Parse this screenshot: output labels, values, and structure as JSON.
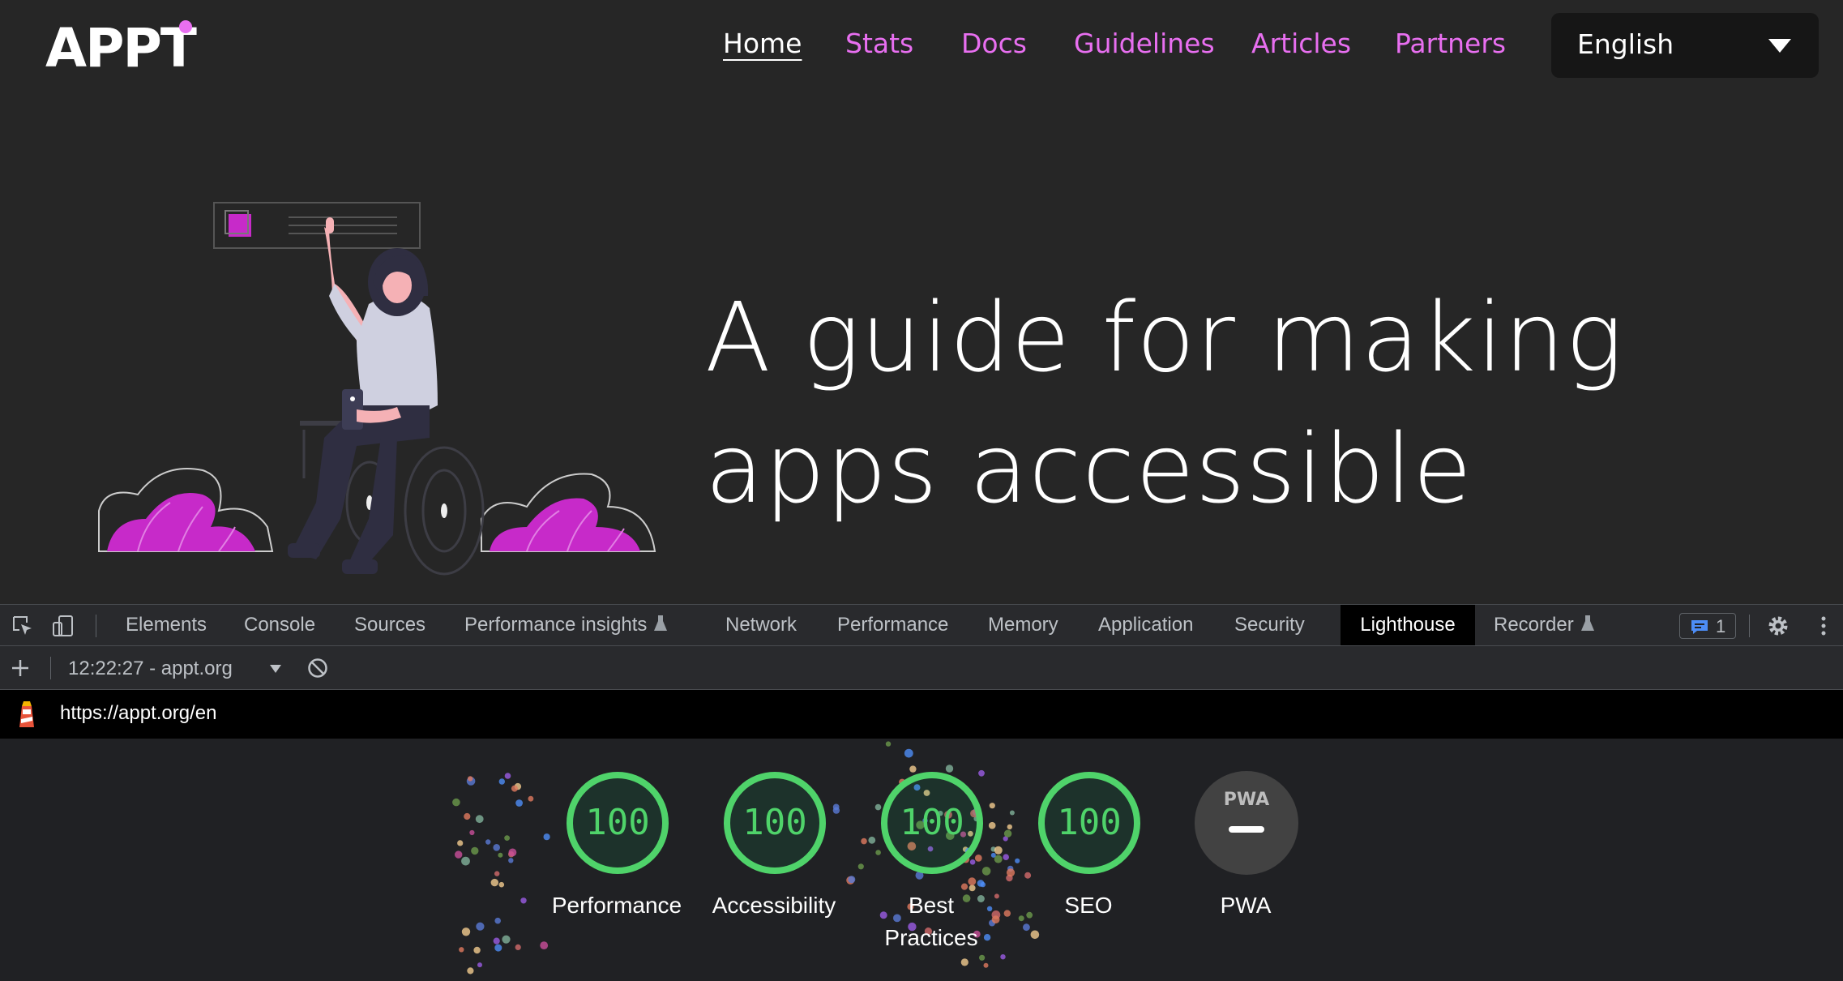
{
  "site": {
    "logo_text": "APPT",
    "nav": [
      {
        "label": "Home",
        "active": true
      },
      {
        "label": "Stats",
        "active": false
      },
      {
        "label": "Docs",
        "active": false
      },
      {
        "label": "Guidelines",
        "active": false
      },
      {
        "label": "Articles",
        "active": false
      },
      {
        "label": "Partners",
        "active": false
      }
    ],
    "language": "English",
    "hero_line1": "A guide for making",
    "hero_line2": "apps accessible",
    "accent_color": "#e86ff0"
  },
  "devtools": {
    "tabs": [
      {
        "label": "Elements"
      },
      {
        "label": "Console"
      },
      {
        "label": "Sources"
      },
      {
        "label": "Performance insights",
        "experimental": true
      },
      {
        "label": "Network"
      },
      {
        "label": "Performance"
      },
      {
        "label": "Memory"
      },
      {
        "label": "Application"
      },
      {
        "label": "Security"
      },
      {
        "label": "Lighthouse",
        "active": true
      },
      {
        "label": "Recorder",
        "experimental": true
      }
    ],
    "issues_count": "1",
    "report_selector": "12:22:27 - appt.org",
    "url": "https://appt.org/en",
    "scores": [
      {
        "category": "Performance",
        "score": "100"
      },
      {
        "category": "Accessibility",
        "score": "100"
      },
      {
        "category": "Best Practices",
        "score": "100"
      },
      {
        "category": "SEO",
        "score": "100"
      },
      {
        "category": "PWA",
        "score": "",
        "badge": "PWA"
      }
    ],
    "pass_color": "#0cce6b"
  }
}
